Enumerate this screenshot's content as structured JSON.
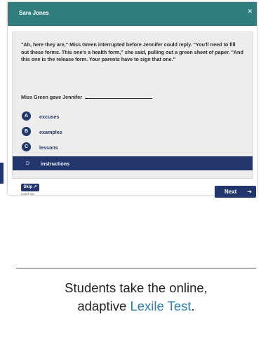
{
  "window": {
    "title": "Sara Jones",
    "close_icon": "close-icon"
  },
  "passage": "\"Ah, here they are,\" Miss Green interrupted before Jennifer could reply. \"You'll need to fill out these forms. This one's a health form,\" she said, pulling out a green sheet of paper. \"And this one is the release form. Your parents have to sign that one.\"",
  "question": {
    "stem": "Miss Green gave Jennifer"
  },
  "options": [
    {
      "letter": "A",
      "label": "excuses"
    },
    {
      "letter": "B",
      "label": "examples"
    },
    {
      "letter": "C",
      "label": "lessons"
    },
    {
      "letter": "D",
      "label": "instructions",
      "selected": true
    }
  ],
  "buttons": {
    "skip": "Skip",
    "skip_sub": "Lexile® Info",
    "next": "Next"
  },
  "colors": {
    "titlebar": "#2f7d7d",
    "navy": "#22366b",
    "accent": "#2a7fb0"
  },
  "caption": {
    "line1": "Students take the online,",
    "line2_prefix": "adaptive ",
    "line2_accent": "Lexile Test",
    "line2_suffix": "."
  }
}
